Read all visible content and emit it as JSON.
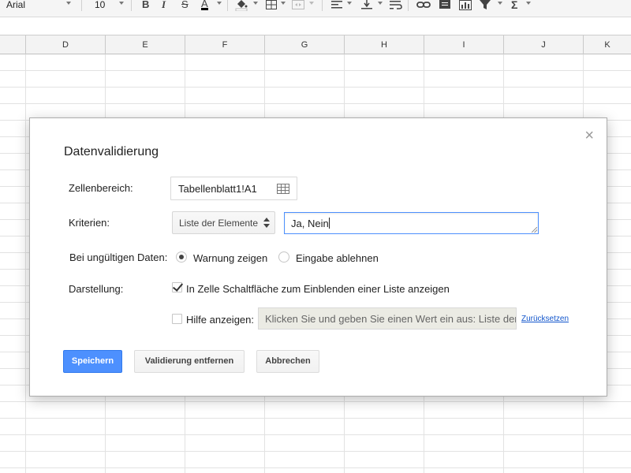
{
  "toolbar": {
    "font_name": "Arial",
    "font_size": "10",
    "bold": "B",
    "italic": "I",
    "strike": "S",
    "text_color": "A",
    "function": "Σ",
    "text_color_underline": "#000000"
  },
  "columns": [
    "D",
    "E",
    "F",
    "G",
    "H",
    "I",
    "J",
    "K"
  ],
  "dialog": {
    "title": "Datenvalidierung",
    "close_glyph": "×",
    "range_label": "Zellenbereich:",
    "range_value": "Tabellenblatt1!A1",
    "criteria_label": "Kriterien:",
    "criteria_type": "Liste der Elemente",
    "criteria_value": "Ja, Nein",
    "invalid_label": "Bei ungültigen Daten:",
    "invalid_options": [
      {
        "label": "Warnung zeigen",
        "selected": true
      },
      {
        "label": "Eingabe ablehnen",
        "selected": false
      }
    ],
    "display_label": "Darstellung:",
    "show_dropdown_label": "In Zelle Schaltfläche zum Einblenden einer Liste anzeigen",
    "show_dropdown_checked": true,
    "help_label": "Hilfe anzeigen:",
    "help_checked": false,
    "help_placeholder": "Klicken Sie und geben Sie einen Wert ein aus: Liste der Elemente",
    "reset_link": "Zurücksetzen",
    "buttons": {
      "save": "Speichern",
      "remove": "Validierung entfernen",
      "cancel": "Abbrechen"
    }
  },
  "colors": {
    "primary_button": "#4d90fe",
    "link": "#1155cc",
    "focus_border": "#4d90fe"
  }
}
